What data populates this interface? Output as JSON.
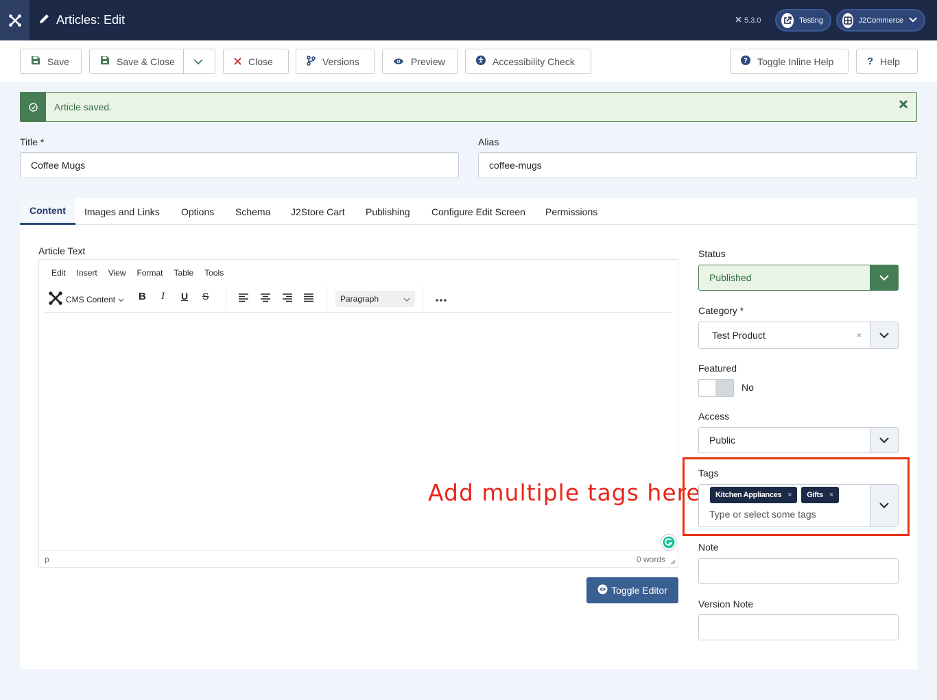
{
  "header": {
    "title": "Articles: Edit",
    "version": "5.3.0",
    "site_pill": "Testing",
    "user_pill": "J2Commerce"
  },
  "toolbar": {
    "save": "Save",
    "save_close": "Save & Close",
    "close": "Close",
    "versions": "Versions",
    "preview": "Preview",
    "accessibility": "Accessibility Check",
    "inline_help": "Toggle Inline Help",
    "help": "Help"
  },
  "alert": {
    "message": "Article saved."
  },
  "fields": {
    "title_label": "Title *",
    "title_value": "Coffee Mugs",
    "alias_label": "Alias",
    "alias_value": "coffee-mugs"
  },
  "tabs": [
    "Content",
    "Images and Links",
    "Options",
    "Schema",
    "J2Store Cart",
    "Publishing",
    "Configure Edit Screen",
    "Permissions"
  ],
  "editor": {
    "label": "Article Text",
    "menu": [
      "Edit",
      "Insert",
      "View",
      "Format",
      "Table",
      "Tools"
    ],
    "cms_content": "CMS Content",
    "block_format": "Paragraph",
    "path": "p",
    "word_count": "0 words",
    "toggle": "Toggle Editor",
    "annotation": "Add multiple tags here"
  },
  "sidebar": {
    "status_label": "Status",
    "status_value": "Published",
    "category_label": "Category *",
    "category_value": "Test Product",
    "featured_label": "Featured",
    "featured_value": "No",
    "access_label": "Access",
    "access_value": "Public",
    "tags_label": "Tags",
    "tags": [
      "Kitchen Appliances",
      "Gifts"
    ],
    "tags_placeholder": "Type or select some tags",
    "note_label": "Note",
    "version_note_label": "Version Note"
  },
  "colors": {
    "header_bg": "#1c2a48",
    "status_green": "#457d54",
    "accent_blue": "#3a6093",
    "annotation_red": "#e8271c"
  }
}
